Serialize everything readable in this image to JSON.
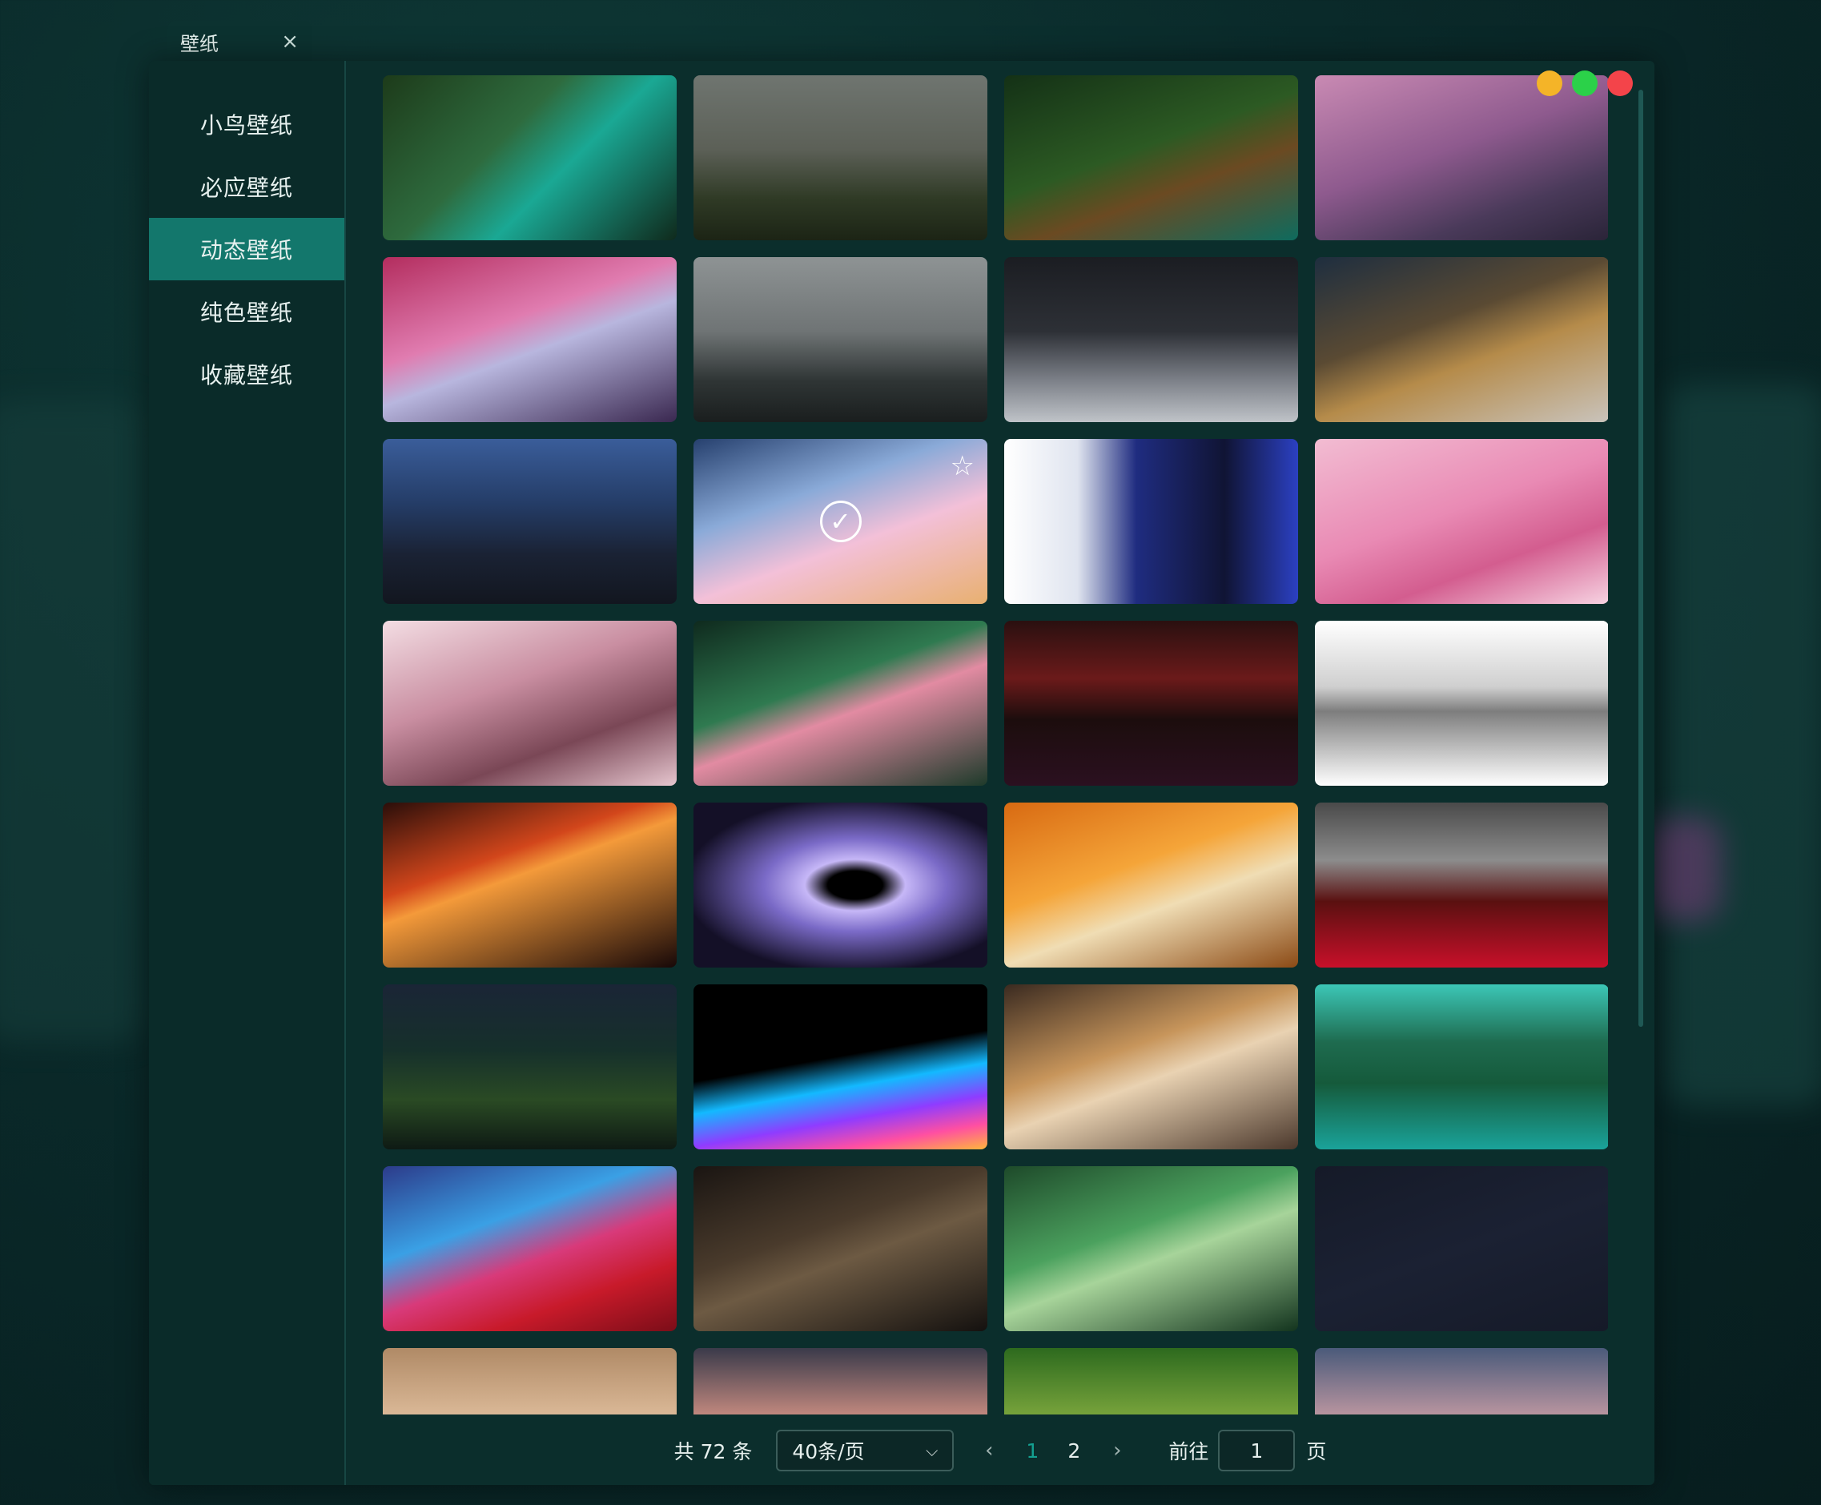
{
  "tab": {
    "title": "壁纸",
    "close": "×"
  },
  "sidebar": {
    "items": [
      {
        "label": "小鸟壁纸",
        "active": false
      },
      {
        "label": "必应壁纸",
        "active": false
      },
      {
        "label": "动态壁纸",
        "active": true
      },
      {
        "label": "纯色壁纸",
        "active": false
      },
      {
        "label": "收藏壁纸",
        "active": false
      }
    ]
  },
  "window_controls": {
    "minimize_color": "#f4b428",
    "maximize_color": "#2bd149",
    "close_color": "#f4444a"
  },
  "wallpapers": [
    {
      "name": "forest-river",
      "bg": "linear-gradient(135deg,#1d3b1a 0%,#2e6b3e 40%,#1aa894 60%,#0f2a1c 100%)"
    },
    {
      "name": "foggy-field",
      "bg": "linear-gradient(180deg,#6f7570 0%,#5c6057 45%,#2f3a25 75%,#1c2415 100%)"
    },
    {
      "name": "forest-cabin",
      "bg": "linear-gradient(160deg,#143116 0%,#2c5a23 45%,#6b4a22 65%,#0e6b5e 100%)"
    },
    {
      "name": "cherry-village",
      "bg": "linear-gradient(160deg,#c98ab3 0%,#8e5a8e 45%,#4a3a5a 75%,#2a2438 100%)"
    },
    {
      "name": "pink-moon-tree",
      "bg": "linear-gradient(160deg,#b32d5e 0%,#e07cb0 40%,#b8b6de 55%,#3a2850 100%)"
    },
    {
      "name": "misty-pines",
      "bg": "linear-gradient(180deg,#8e9394 0%,#6f7475 45%,#2f3535 75%,#1a1e1e 100%)"
    },
    {
      "name": "snow-forest-night",
      "bg": "linear-gradient(180deg,#1b1d22 0%,#2d3036 45%,#7d8189 75%,#bfc3c8 100%)"
    },
    {
      "name": "snowy-street",
      "bg": "linear-gradient(160deg,#1e2e3f 0%,#5a4a33 40%,#b58b4a 60%,#c9c3bb 100%)"
    },
    {
      "name": "rain-city",
      "bg": "linear-gradient(180deg,#3a5d9a 0%,#243c66 40%,#1a2234 70%,#12161f 100%)"
    },
    {
      "name": "anime-street-trees",
      "bg": "linear-gradient(160deg,#26406e 0%,#8aaad8 35%,#f3c0d8 60%,#e8b070 100%)",
      "selected": true
    },
    {
      "name": "anime-girl-flower",
      "bg": "linear-gradient(90deg,#ffffff 0%,#dfe4ef 25%,#1f2c80 45%,#101434 75%,#2b40c2 100%)"
    },
    {
      "name": "pink-fox-girl",
      "bg": "linear-gradient(160deg,#f2bcd2 0%,#e98ab4 45%,#d35d8f 70%,#f7d3e2 100%)"
    },
    {
      "name": "pink-hair-girl",
      "bg": "linear-gradient(160deg,#f3dde3 0%,#c98ea1 40%,#7a4756 70%,#e6c6cf 100%)"
    },
    {
      "name": "window-garden",
      "bg": "linear-gradient(160deg,#0f2a1e 0%,#2f7a50 40%,#e28ba2 55%,#1d3a2a 100%)"
    },
    {
      "name": "eclipse",
      "bg": "linear-gradient(180deg,#2a1010 0%,#6b1a1a 35%,#1c0d0d 60%,#2b1020 100%)"
    },
    {
      "name": "ink-samurai",
      "bg": "linear-gradient(180deg,#ffffff 0%,#cfcfcf 40%,#7d7d7d 55%,#ffffff 100%)"
    },
    {
      "name": "red-fox-forest",
      "bg": "linear-gradient(160deg,#2a0e0a 0%,#d2461b 35%,#f49a3a 45%,#170808 100%)"
    },
    {
      "name": "black-hole",
      "bg": "radial-gradient(ellipse at 55% 50%,#000000 0%,#000 12%,#c6b7f7 22%,#7a6ac7 40%,#141027 75%)"
    },
    {
      "name": "autumn-road",
      "bg": "linear-gradient(160deg,#d86a12 0%,#f5a539 40%,#f0ddb4 60%,#8b4a15 100%)"
    },
    {
      "name": "red-poppy-field",
      "bg": "linear-gradient(180deg,#4a4a4a 0%,#8c8c8c 35%,#5a1010 60%,#c8102a 100%)"
    },
    {
      "name": "night-path",
      "bg": "linear-gradient(180deg,#1a2536 0%,#16302b 40%,#2a4a24 70%,#0e1a14 100%)"
    },
    {
      "name": "color-wave-black",
      "bg": "linear-gradient(170deg,#000000 0%,#000 45%,#13b9ff 60%,#8f3cff 75%,#ff4fa2 88%,#ffb63c 100%)"
    },
    {
      "name": "anime-cat",
      "bg": "linear-gradient(160deg,#3a2a20 0%,#c7955b 40%,#e9d2b2 55%,#4b382c 100%)"
    },
    {
      "name": "green-lake-valley",
      "bg": "linear-gradient(180deg,#3cc7b7 0%,#1e6b4f 35%,#155a3b 60%,#1aa39a 100%)"
    },
    {
      "name": "macos-wave",
      "bg": "linear-gradient(160deg,#2c3b8a 0%,#3aa0e5 35%,#d83a7a 55%,#c81a2a 75%,#7b0d18 100%)"
    },
    {
      "name": "monkey-king",
      "bg": "linear-gradient(160deg,#1a1512 0%,#4a3b2c 40%,#6d5a43 55%,#14110f 100%)"
    },
    {
      "name": "green-canyon",
      "bg": "linear-gradient(160deg,#1e4a2a 0%,#4ba15e 40%,#a7d49a 55%,#13341e 100%)"
    },
    {
      "name": "neon-laptop-cat",
      "bg": "linear-gradient(160deg,#151a28 0%,#1b2133 50%,#151a28 100%)"
    },
    {
      "name": "fantasy-girl",
      "bg": "linear-gradient(180deg,#b08a66 0%,#e4c3a2 50%,#8a6a52 100%)"
    },
    {
      "name": "sunset-cherry",
      "bg": "linear-gradient(180deg,#3a3a4a 0%,#e09a8a 50%,#c4727a 100%)"
    },
    {
      "name": "jungle",
      "bg": "linear-gradient(180deg,#2d6a1e 0%,#88b042 50%,#1e4a15 100%)"
    },
    {
      "name": "mountain-cherry",
      "bg": "linear-gradient(180deg,#4a5a7a 0%,#d2a2a8 50%,#8a6a7a 100%)"
    }
  ],
  "pagination": {
    "total": "共 72 条",
    "page_size": "40条/页",
    "prev": "‹",
    "next": "›",
    "pages": [
      "1",
      "2"
    ],
    "current_page": "1",
    "goto_label": "前往",
    "goto_value": "1",
    "goto_suffix": "页",
    "active_color": "#13a091"
  }
}
